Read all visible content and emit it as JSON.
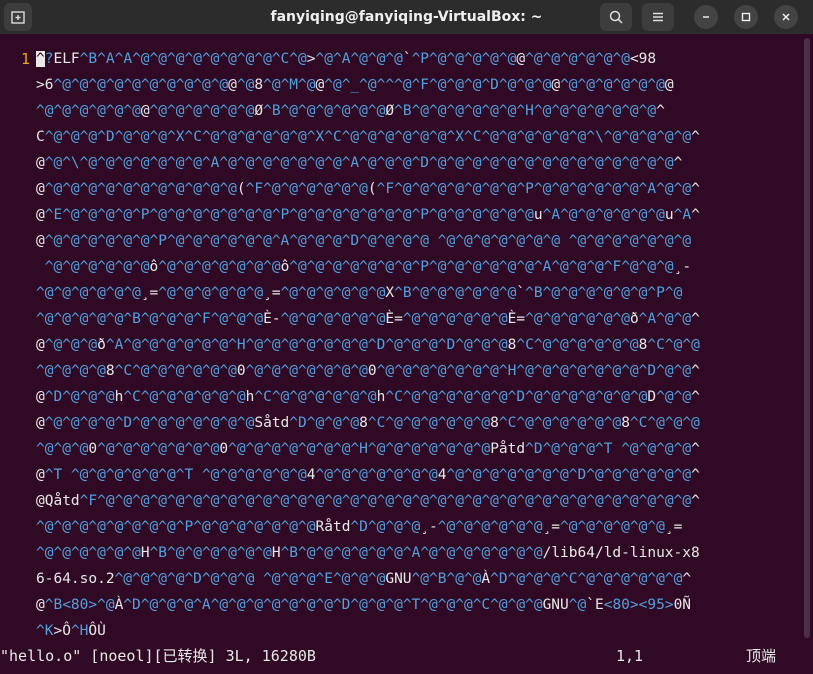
{
  "window": {
    "title": "fanyiqing@fanyiqing-VirtualBox: ~",
    "icons": [
      "new-tab-icon",
      "search-icon",
      "hamburger-menu-icon",
      "minimize-icon",
      "maximize-icon",
      "close-icon"
    ]
  },
  "editor": {
    "line_number": "1",
    "lines": [
      "^?ELF^B^A^A^@^@^@^@^@^@^@^@^C^@>^@^A^@^@^@`^P^@^@^@^@^@@^@^@^@^@^@^@<98",
      ">6^@^@^@^@^@^@^@^@^@^@@^@8^@^M^@@^@^_^@^^^@^F^@^@^@^D^@^@^@@^@^@^@^@^@^@@",
      "^@^@^@^@^@^@@^@^@^@^@^@^@Ø^B^@^@^@^@^@^@Ø^B^@^@^@^@^@^@^H^@^@^@^@^@^@^@^",
      "C^@^@^@^D^@^@^@^X^C^@^@^@^@^@^@^X^C^@^@^@^@^@^@^X^C^@^@^@^@^@^@^\\^@^@^@^@^@^",
      "@^@^\\^@^@^@^@^@^@^@^A^@^@^@^@^@^@^@^A^@^@^@^D^@^@^@^@^@^@^@^@^@^@^@^@^@^@^",
      "@^@^@^@^@^@^@^@^@^@^@^@(^F^@^@^@^@^@^@(^F^@^@^@^@^@^@^@^P^@^@^@^@^@^@^A^@^@^",
      "@^E^@^@^@^@^P^@^@^@^@^@^@^@^P^@^@^@^@^@^@^@^P^@^@^@^@^@^@u^A^@^@^@^@^@^@u^A^",
      "@^@^@^@^@^@^@^P^@^@^@^@^@^@^A^@^@^@^D^@^@^@^@ ^@^@^@^@^@^@^@ ^@^@^@^@^@^@^@",
      " ^@^@^@^@^@^@ô^@^@^@^@^@^@^@ô^@^@^@^@^@^@^@^P^@^@^@^@^@^@^A^@^@^@^F^@^@^@¸-",
      "^@^@^@^@^@^@¸=^@^@^@^@^@^@¸=^@^@^@^@^@^@X^B^@^@^@^@^@^@`^B^@^@^@^@^@^@^P^@",
      "^@^@^@^@^@^B^@^@^@^F^@^@^@È-^@^@^@^@^@^@È=^@^@^@^@^@^@È=^@^@^@^@^@^@ð^A^@^@^",
      "@^@^@^@ð^A^@^@^@^@^@^@^H^@^@^@^@^@^@^@^D^@^@^@^D^@^@^@8^C^@^@^@^@^@^@8^C^@^@",
      "^@^@^@^@8^C^@^@^@^@^@^@0^@^@^@^@^@^@^@0^@^@^@^@^@^@^@^H^@^@^@^@^@^@^@^D^@^@^",
      "@^D^@^@^@h^C^@^@^@^@^@^@h^C^@^@^@^@^@^@h^C^@^@^@^@^@^@^D^@^@^@^@^@^@^@D^@^@^",
      "@^@^@^@^@^D^@^@^@^@^@^@^@Såtd^D^@^@^@8^C^@^@^@^@^@^@8^C^@^@^@^@^@^@8^C^@^@^@",
      "^@^@^@0^@^@^@^@^@^@^@0^@^@^@^@^@^@^@^H^@^@^@^@^@^@^@Påtd^D^@^@^@^T ^@^@^@^@^",
      "@^T ^@^@^@^@^@^@^T ^@^@^@^@^@^@4^@^@^@^@^@^@^@4^@^@^@^@^@^@^@^D^@^@^@^@^@^@^",
      "@Qåtd^F^@^@^@^@^@^@^@^@^@^@^@^@^@^@^@^@^@^@^@^@^@^@^@^@^@^@^@^@^@^@^@^@^@^@^",
      "^@^@^@^@^@^@^@^@^P^@^@^@^@^@^@^@Råtd^D^@^@^@¸-^@^@^@^@^@^@¸=^@^@^@^@^@^@¸=",
      "^@^@^@^@^@^@H^B^@^@^@^@^@^@H^B^@^@^@^@^@^@^A^@^@^@^@^@^@^@/lib64/ld-linux-x8",
      "6-64.so.2^@^@^@^@^D^@^@^@ ^@^@^@^E^@^@^@GNU^@^B^@^@À^D^@^@^@^C^@^@^@^@^@^@^",
      "@^B<80>^@À^D^@^@^@^A^@^@^@^@^@^@^@^D^@^@^@^T^@^@^@^C^@^@^@GNU^@`E<80><95>0Ñ",
      "^K>Ô^HÔÙ"
    ]
  },
  "status": {
    "file_info": "\"hello.o\" [noeol][已转换] 3L, 16280B",
    "position": "1,1",
    "scroll": "顶端"
  },
  "colors": {
    "background": "#300a24",
    "titlebar": "#2c2c2c",
    "line_number": "#e8a51a",
    "control_char": "#54a0de",
    "text": "#e8e8e8"
  }
}
